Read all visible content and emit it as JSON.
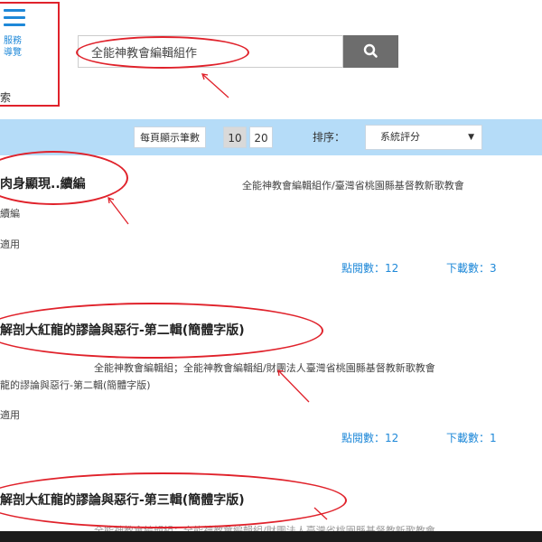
{
  "nav": {
    "line1": "服務",
    "line2": "導覽",
    "side_label": "索"
  },
  "search": {
    "value": "全能神教會編輯組作",
    "button_icon": "search-icon"
  },
  "filter": {
    "per_page_label": "每頁顯示筆數",
    "per_page_options": [
      "10",
      "20"
    ],
    "per_page_selected": "10",
    "sort_label": "排序：",
    "sort_value": "系統評分",
    "sort_caret": "▼"
  },
  "results": [
    {
      "title": "肉身顯現..續編",
      "author": "全能神教會編輯組作/臺灣省桃園縣基督教新歌教會",
      "subtitle": "續編",
      "category": "適用",
      "views": "點閱數：12",
      "downloads": "下載數：3"
    },
    {
      "title": "解剖大紅龍的謬論與惡行-第二輯(簡體字版)",
      "author": "全能神教會編輯組；全能神教會編輯組/財團法人臺灣省桃園縣基督教新歌教會",
      "subtitle": "龍的謬論與惡行-第二輯(簡體字版)",
      "category": "適用",
      "views": "點閱數：12",
      "downloads": "下載數：1"
    },
    {
      "title": "解剖大紅龍的謬論與惡行-第三輯(簡體字版)",
      "author": "全能神教會編輯組；全能神教會編輯組/財團法人臺灣省桃園縣基督教新歌教會"
    }
  ],
  "colors": {
    "annotation": "#e0222b",
    "accent": "#1e88d8",
    "filter_bar": "#b5dcf8",
    "search_button": "#6d6d6d"
  }
}
